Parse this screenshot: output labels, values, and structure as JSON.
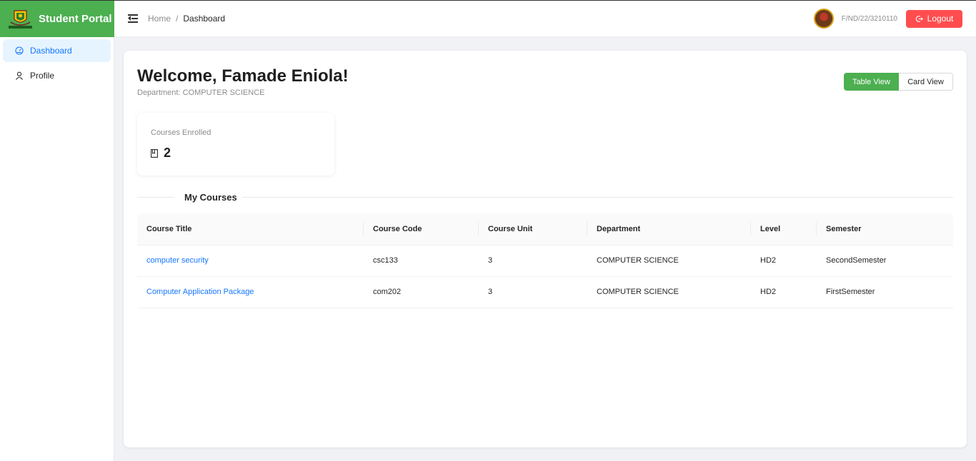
{
  "brand": {
    "title": "Student Portal",
    "logo": "school-crest-logo"
  },
  "header": {
    "breadcrumb": {
      "home": "Home",
      "separator": "/",
      "current": "Dashboard"
    },
    "reg_no": "F/ND/22/3210110",
    "logout_label": "Logout"
  },
  "sidebar": {
    "items": [
      {
        "label": "Dashboard",
        "icon": "dashboard-icon"
      },
      {
        "label": "Profile",
        "icon": "user-icon"
      }
    ]
  },
  "main": {
    "welcome": "Welcome, Famade Eniola!",
    "department_line": "Department: COMPUTER SCIENCE",
    "view_toggle": {
      "table": "Table View",
      "card": "Card View",
      "selected": "Table View"
    },
    "stat": {
      "label": "Courses Enrolled",
      "value": "2",
      "icon": "book-icon"
    },
    "section_title": "My Courses",
    "table": {
      "headers": [
        "Course Title",
        "Course Code",
        "Course Unit",
        "Department",
        "Level",
        "Semester"
      ],
      "rows": [
        [
          "computer security",
          "csc133",
          "3",
          "COMPUTER SCIENCE",
          "HD2",
          "SecondSemester"
        ],
        [
          "Computer Application Package",
          "com202",
          "3",
          "COMPUTER SCIENCE",
          "HD2",
          "FirstSemester"
        ]
      ]
    }
  },
  "colors": {
    "brand_green": "#4caf50",
    "link_blue": "#1677ff",
    "logout_red": "#ff4d4f"
  }
}
